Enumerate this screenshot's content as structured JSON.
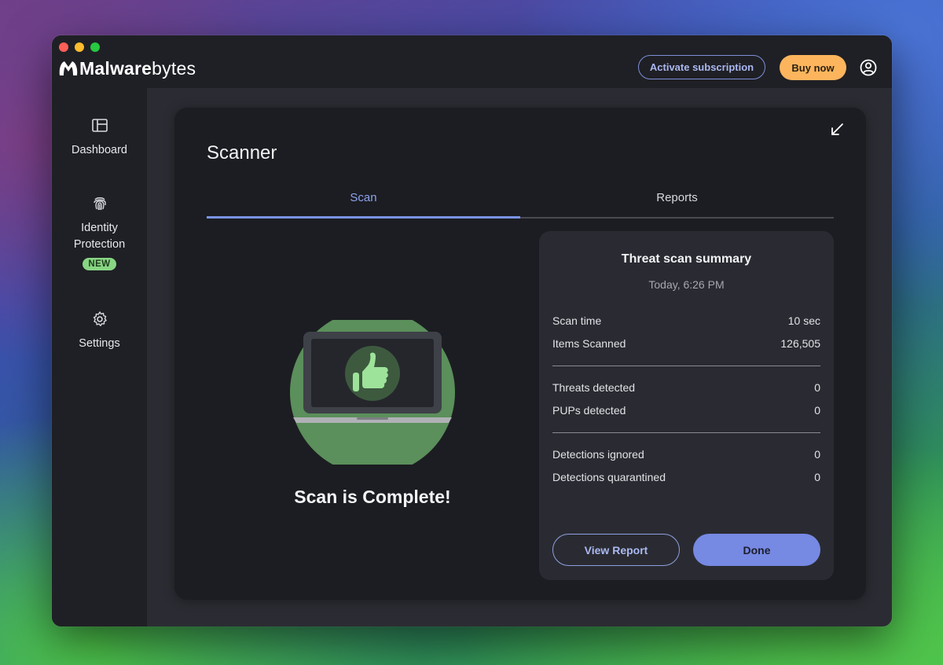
{
  "app": {
    "brand_bold": "Malware",
    "brand_light": "bytes"
  },
  "header": {
    "activate_label": "Activate subscription",
    "buy_label": "Buy now"
  },
  "sidebar": {
    "items": [
      {
        "label": "Dashboard",
        "icon": "dashboard-icon"
      },
      {
        "label": "Identity Protection",
        "icon": "fingerprint-icon",
        "badge": "NEW"
      },
      {
        "label": "Settings",
        "icon": "gear-icon"
      }
    ]
  },
  "scanner": {
    "title": "Scanner",
    "tabs": [
      {
        "label": "Scan",
        "active": true
      },
      {
        "label": "Reports",
        "active": false
      }
    ],
    "status_message": "Scan is Complete!"
  },
  "summary": {
    "title": "Threat scan summary",
    "date": "Today, 6:26 PM",
    "rows": [
      {
        "label": "Scan time",
        "value": "10 sec"
      },
      {
        "label": "Items Scanned",
        "value": "126,505"
      },
      {
        "label": "Threats detected",
        "value": "0"
      },
      {
        "label": "PUPs detected",
        "value": "0"
      },
      {
        "label": "Detections ignored",
        "value": "0"
      },
      {
        "label": "Detections quarantined",
        "value": "0"
      }
    ],
    "view_report_label": "View Report",
    "done_label": "Done"
  },
  "colors": {
    "accent": "#7b93e6",
    "buy": "#fdb55d",
    "success": "#88d683"
  }
}
